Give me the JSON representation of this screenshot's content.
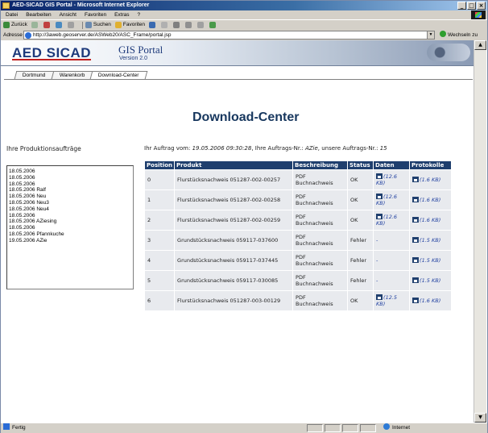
{
  "window": {
    "title": "AED-SICAD GIS Portal - Microsoft Internet Explorer",
    "buttons": [
      "_",
      "□",
      "×"
    ]
  },
  "menubar": {
    "items": [
      "Datei",
      "Bearbeiten",
      "Ansicht",
      "Favoriten",
      "Extras",
      "?"
    ]
  },
  "toolbar": {
    "back_label": "Zurück",
    "search_label": "Suchen",
    "favorites_label": "Favoriten"
  },
  "addressbar": {
    "label": "Adresse",
    "url": "http://3aweb.geoserver.de/ASWeb20/ASC_Frame/portal.jsp",
    "go_label": "Wechseln zu"
  },
  "header": {
    "logo": "AED SICAD",
    "portal_title": "GIS Portal",
    "version": "Version 2.0"
  },
  "tabs": [
    "Dortmund",
    "Warenkorb",
    "Download-Center"
  ],
  "page_title": "Download-Center",
  "orders": {
    "label": "Ihre Produktionsaufträge",
    "items": [
      "18.05.2006",
      "18.05.2006",
      "18.05.2006",
      "18.05.2006 Ralf",
      "18.05.2006 Neu",
      "18.05.2006 Neu3",
      "18.05.2006 Neu4",
      "18.05.2006",
      "18.05.2006 AZiesing",
      "18.05.2006",
      "18.05.2006 Pfannkuche",
      "19.05.2006 AZie"
    ]
  },
  "order_info": {
    "prefix": "Ihr Auftrag vom: ",
    "date": "19.05.2006 09:30:28",
    "mid": ", Ihre Auftrags-Nr.: ",
    "own_no": "AZie",
    "mid2": ", unsere Auftrags-Nr.: ",
    "our_no": "15"
  },
  "table": {
    "headers": [
      "Position",
      "Produkt",
      "Beschreibung",
      "Status",
      "Daten",
      "Protokolle"
    ],
    "rows": [
      {
        "pos": "0",
        "product": "Flurstücksnachweis 051287-002-00257",
        "desc": "PDF Buchnachweis",
        "status": "OK",
        "data": "(12.6 KB)",
        "log": "(1.6 KB)"
      },
      {
        "pos": "1",
        "product": "Flurstücksnachweis 051287-002-00258",
        "desc": "PDF Buchnachweis",
        "status": "OK",
        "data": "(12.6 KB)",
        "log": "(1.6 KB)"
      },
      {
        "pos": "2",
        "product": "Flurstücksnachweis 051287-002-00259",
        "desc": "PDF Buchnachweis",
        "status": "OK",
        "data": "(12.6 KB)",
        "log": "(1.6 KB)"
      },
      {
        "pos": "3",
        "product": "Grundstücksnachweis 059117-037600",
        "desc": "PDF Buchnachweis",
        "status": "Fehler",
        "data": "-",
        "log": "(1.5 KB)"
      },
      {
        "pos": "4",
        "product": "Grundstücksnachweis 059117-037445",
        "desc": "PDF Buchnachweis",
        "status": "Fehler",
        "data": "-",
        "log": "(1.5 KB)"
      },
      {
        "pos": "5",
        "product": "Grundstücksnachweis 059117-030085",
        "desc": "PDF Buchnachweis",
        "status": "Fehler",
        "data": "-",
        "log": "(1.5 KB)"
      },
      {
        "pos": "6",
        "product": "Flurstücksnachweis 051287-003-00129",
        "desc": "PDF Buchnachweis",
        "status": "OK",
        "data": "(12.5 KB)",
        "log": "(1.6 KB)"
      }
    ]
  },
  "statusbar": {
    "ready": "Fertig",
    "zone": "Internet"
  },
  "colors": {
    "header_bg": "#1f3f6e",
    "title": "#17375e",
    "link": "#2040a0",
    "cell_bg": "#e8eaee"
  }
}
